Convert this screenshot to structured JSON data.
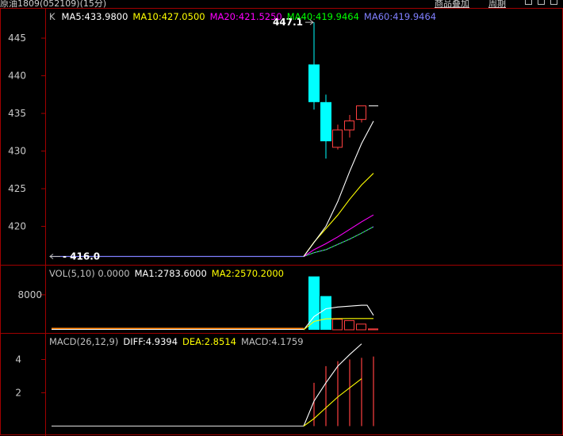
{
  "window": {
    "title": "原油1809(052109)(15分)",
    "buttons": [
      "商品叠加",
      "周期"
    ]
  },
  "colors": {
    "background": "#000000",
    "frame": "#a00000",
    "up": "#ff4040",
    "down": "#00ffff",
    "ma5": "#ffffff",
    "ma10": "#ffff00",
    "ma20": "#ff00ff",
    "ma40": "#00ff00",
    "ma60": "#8080ff",
    "diff": "#ffffff",
    "dea": "#ffff00",
    "vol_base": "#ff8000"
  },
  "price_panel": {
    "legend": {
      "k": "K",
      "ma5": "MA5:433.9800",
      "ma10": "MA10:427.0500",
      "ma20": "MA20:421.5250",
      "ma40": "MA40:419.9464",
      "ma60": "MA60:419.9464"
    },
    "high_label": "447.1",
    "low_label": "416.0"
  },
  "vol_panel": {
    "legend": {
      "name": "VOL(5,10) 0.0000",
      "ma1": "MA1:2783.6000",
      "ma2": "MA2:2570.2000"
    }
  },
  "macd_panel": {
    "legend": {
      "name": "MACD(26,12,9)",
      "diff": "DIFF:4.9394",
      "dea": "DEA:2.8514",
      "macd": "MACD:4.1759"
    }
  },
  "chart_data": [
    {
      "type": "candlestick",
      "yticks": [
        "445",
        "440",
        "435",
        "430",
        "425",
        "420"
      ],
      "ylim": [
        415,
        448.8
      ],
      "flat_price": 416.0,
      "candles": [
        {
          "open": 441.5,
          "close": 436.5,
          "high": 447.1,
          "low": 435.5
        },
        {
          "open": 436.5,
          "close": 431.3,
          "high": 437.5,
          "low": 429.0
        },
        {
          "open": 430.5,
          "close": 432.8,
          "high": 433.5,
          "low": 430.2
        },
        {
          "open": 432.8,
          "close": 434.0,
          "high": 434.8,
          "low": 431.8
        },
        {
          "open": 434.2,
          "close": 436.0,
          "high": 436.0,
          "low": 433.8
        },
        {
          "open": 436.0,
          "close": 436.0,
          "high": 436.0,
          "low": 436.0
        }
      ],
      "ma_lines": {
        "ma5": [
          416.0,
          420.0,
          423.3,
          427.3,
          431.0,
          433.98
        ],
        "ma10": [
          416.0,
          417.9,
          419.7,
          421.5,
          423.6,
          425.5,
          427.05
        ],
        "ma20": [
          416.0,
          416.9,
          417.7,
          418.6,
          419.6,
          420.6,
          421.52
        ],
        "ma40": [
          416.0,
          416.5,
          416.9,
          417.6,
          418.3,
          419.1,
          419.95
        ],
        "ma60": [
          416.0,
          416.5,
          416.9,
          417.6,
          418.3,
          419.1,
          419.95
        ]
      }
    },
    {
      "type": "bar",
      "ytick": "8000",
      "ylim": [
        0,
        14500
      ],
      "bars": [
        {
          "value": 12200,
          "direction": "down"
        },
        {
          "value": 7700,
          "direction": "down"
        },
        {
          "value": 2400,
          "direction": "up"
        },
        {
          "value": 2100,
          "direction": "up"
        },
        {
          "value": 1300,
          "direction": "up"
        },
        {
          "value": 200,
          "direction": "up"
        }
      ],
      "ma1": [
        0,
        3000,
        4800,
        5200,
        5400,
        5600,
        5600,
        3300
      ],
      "ma2": [
        0,
        1900,
        2500,
        2550,
        2570,
        2570,
        2570
      ]
    },
    {
      "type": "macd",
      "yticks": [
        "4",
        "2"
      ],
      "ylim": [
        -0.5,
        5.5
      ],
      "diff": [
        0.0,
        1.5,
        2.6,
        3.6,
        4.3,
        4.94
      ],
      "dea": [
        0.0,
        0.45,
        1.1,
        1.75,
        2.3,
        2.85
      ],
      "macd_bars": [
        2.6,
        3.6,
        3.9,
        4.0,
        4.1,
        4.18
      ]
    }
  ]
}
